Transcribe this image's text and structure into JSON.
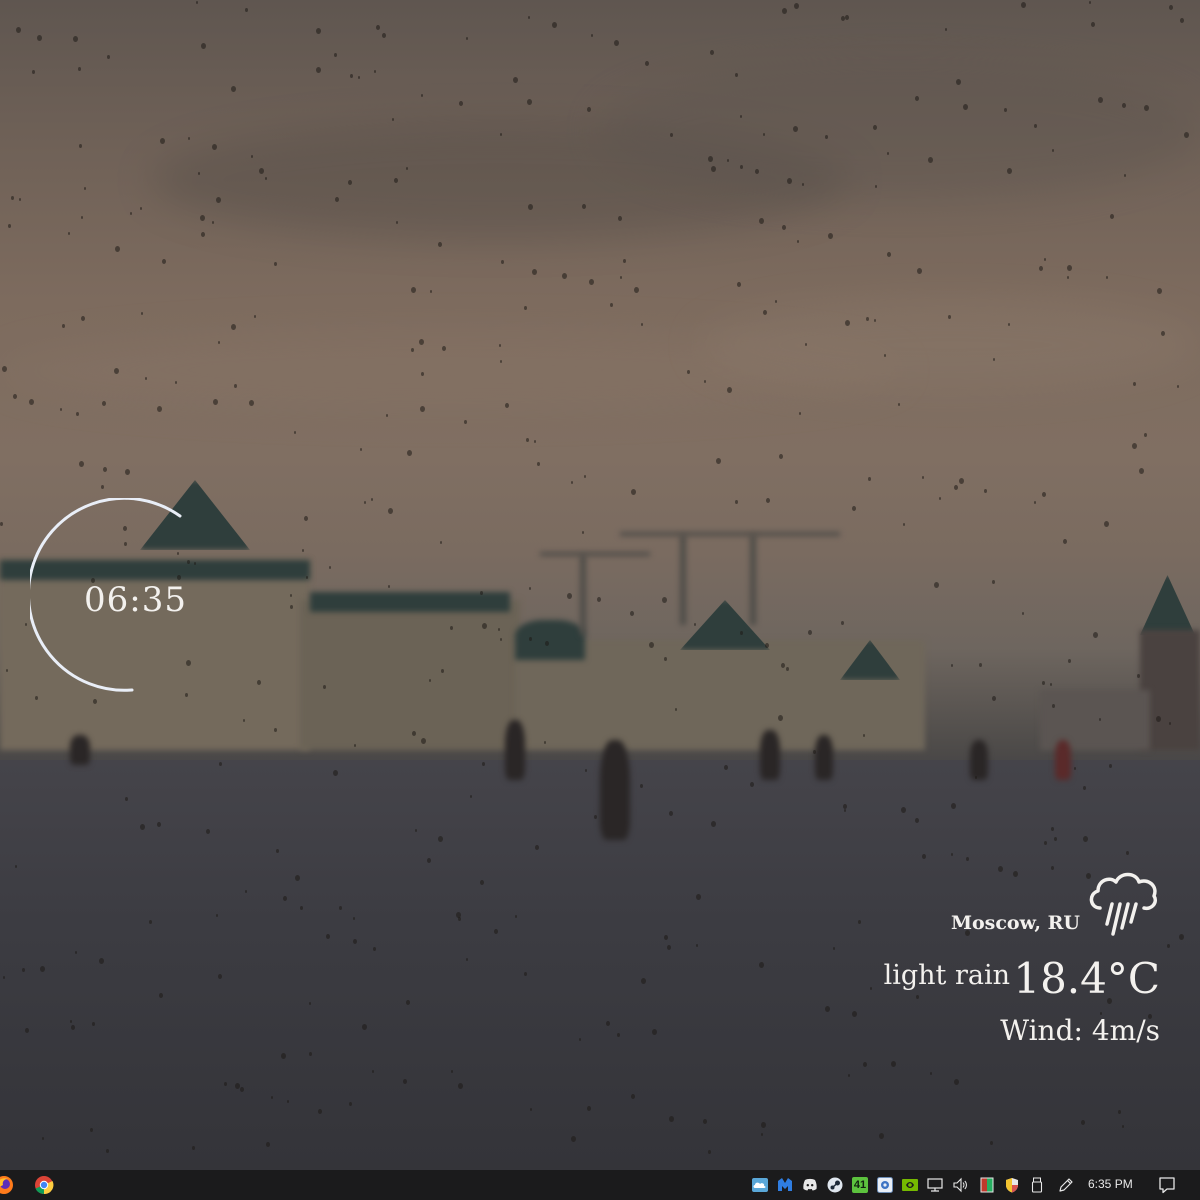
{
  "clock_widget": {
    "time": "06:35"
  },
  "weather_widget": {
    "location": "Moscow, RU",
    "condition": "light rain",
    "temperature": "18.4°C",
    "wind": "Wind: 4m/s",
    "icon": "rain-cloud-icon"
  },
  "taskbar": {
    "pinned_apps": [
      "firefox-icon",
      "chrome-icon"
    ],
    "tray_icons": [
      "weather-tray-icon",
      "malwarebytes-icon",
      "discord-icon",
      "steam-icon",
      "badge-41-icon",
      "app-tray-icon",
      "nvidia-icon",
      "network-icon",
      "volume-icon",
      "battery-icon",
      "shield-icon",
      "usb-icon",
      "pen-icon"
    ],
    "tray_badge_number": "41",
    "clock": "6:35 PM",
    "action_center": "notification-icon"
  },
  "colors": {
    "widget_text": "#f3f1ee",
    "taskbar_bg": "#1b1b1c",
    "nvidia_green": "#76b900"
  }
}
